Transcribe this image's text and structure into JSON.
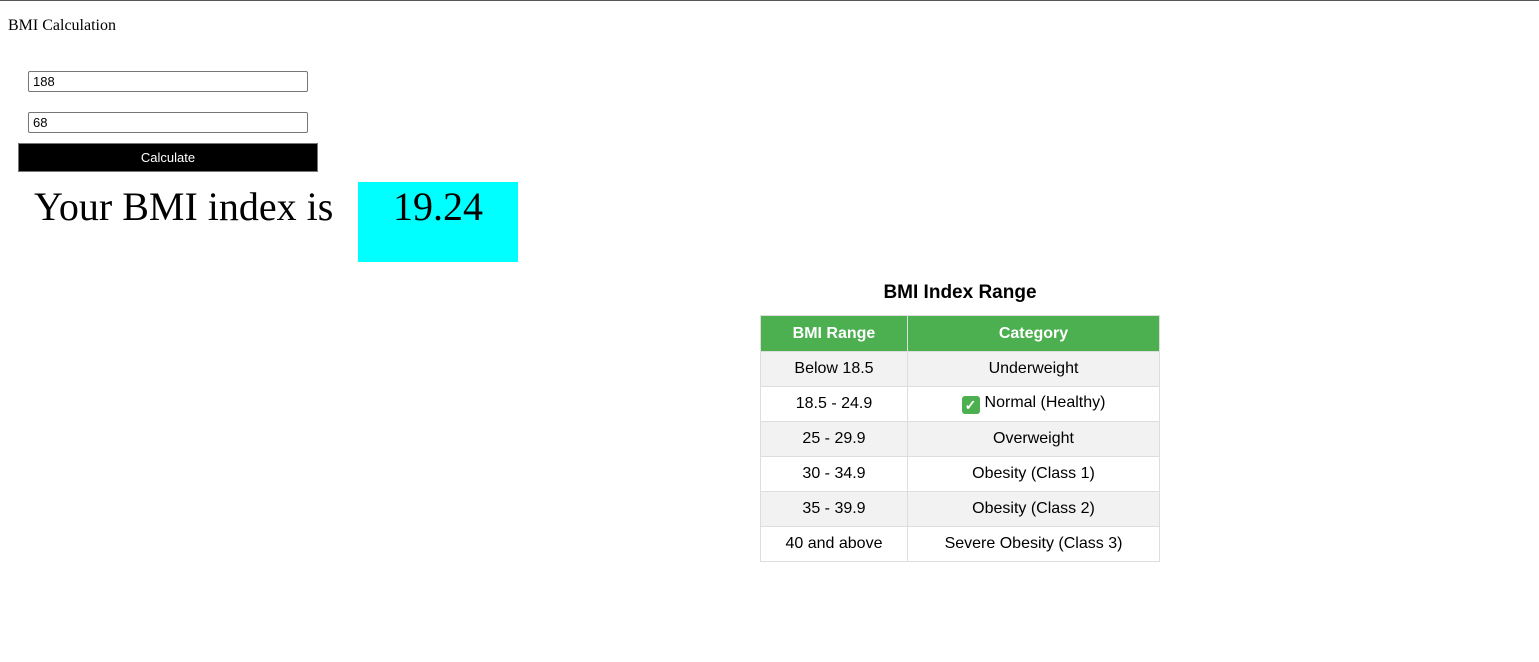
{
  "page": {
    "title": "BMI Calculation"
  },
  "form": {
    "height_value": "188",
    "weight_value": "68",
    "calculate_label": "Calculate"
  },
  "result": {
    "label": "Your BMI index is",
    "value": "19.24",
    "box_color": "#00ffff"
  },
  "range_table": {
    "title": "BMI Index Range",
    "header_color": "#4caf50",
    "columns": [
      "BMI Range",
      "Category"
    ],
    "rows": [
      {
        "range": "Below 18.5",
        "category": "Underweight",
        "icon": ""
      },
      {
        "range": "18.5 - 24.9",
        "category": "Normal (Healthy)",
        "icon": "check-mark-icon"
      },
      {
        "range": "25 - 29.9",
        "category": "Overweight",
        "icon": ""
      },
      {
        "range": "30 - 34.9",
        "category": "Obesity (Class 1)",
        "icon": ""
      },
      {
        "range": "35 - 39.9",
        "category": "Obesity (Class 2)",
        "icon": ""
      },
      {
        "range": "40 and above",
        "category": "Severe Obesity (Class 3)",
        "icon": ""
      }
    ]
  }
}
